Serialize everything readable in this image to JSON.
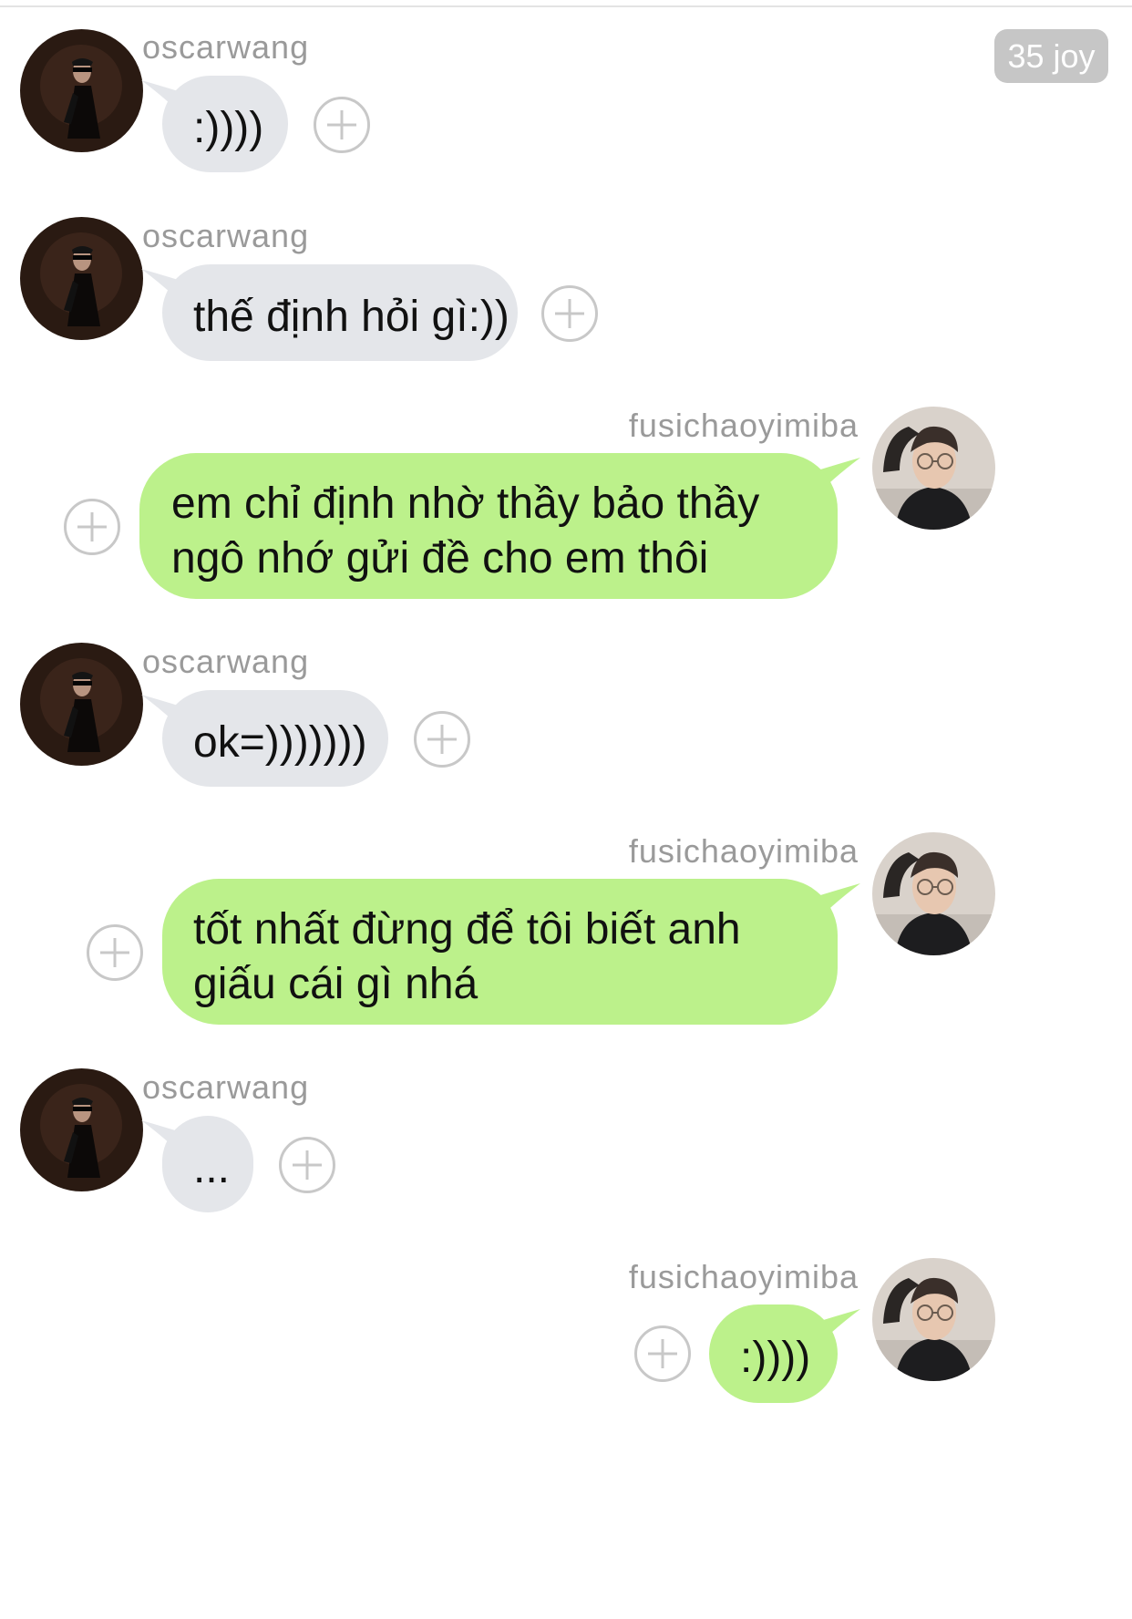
{
  "header": {
    "badge": "35 joy"
  },
  "users": {
    "other": "oscarwang",
    "self": "fusichaoyimiba"
  },
  "messages": [
    {
      "sender": "oscarwang",
      "text": ":))))"
    },
    {
      "sender": "oscarwang",
      "text": "thế định hỏi gì:))"
    },
    {
      "sender": "fusichaoyimiba",
      "text": "em chỉ định nhờ thầy bảo thầy ngô nhớ gửi đề cho em thôi"
    },
    {
      "sender": "oscarwang",
      "text": "ok=)))))))"
    },
    {
      "sender": "fusichaoyimiba",
      "text": "tốt nhất đừng để tôi biết anh giấu cái gì nhá"
    },
    {
      "sender": "oscarwang",
      "text": "..."
    },
    {
      "sender": "fusichaoyimiba",
      "text": ":))))"
    }
  ],
  "colors": {
    "incoming_bubble": "#e4e6ea",
    "outgoing_bubble": "#bcf18b",
    "username": "#9a9a9a",
    "badge": "#c6c6c6"
  }
}
